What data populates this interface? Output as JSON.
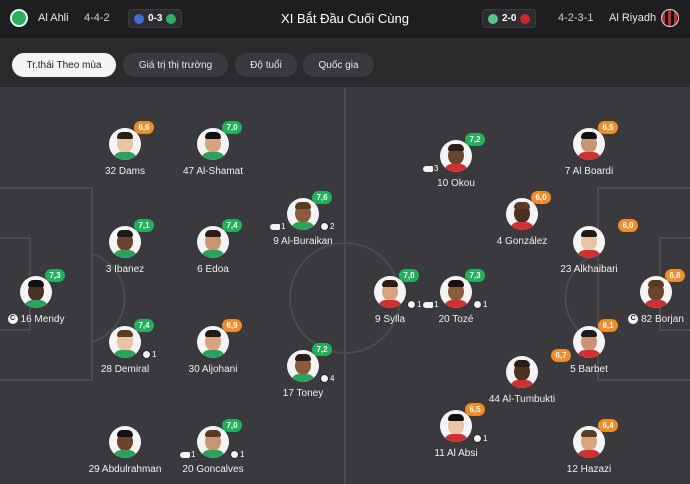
{
  "header": {
    "home_team": "Al Ahli",
    "home_formation": "4-4-2",
    "home_recent_score": "0-3",
    "title": "XI Bắt Đầu Cuối Cùng",
    "away_recent_score": "2-0",
    "away_formation": "4-2-3-1",
    "away_team": "Al Riyadh"
  },
  "tabs": [
    {
      "label": "Tr.thái Theo mùa",
      "active": true
    },
    {
      "label": "Giá trị thị trường",
      "active": false
    },
    {
      "label": "Độ tuổi",
      "active": false
    },
    {
      "label": "Quốc gia",
      "active": false
    }
  ],
  "colors": {
    "rating_green": "#21b15b",
    "rating_orange": "#f08d2a",
    "rating_red": "#e5483c",
    "pitch": "#3a3a3e"
  },
  "home_players": [
    {
      "name": "32 Dams",
      "rating": "6,6"
    },
    {
      "name": "47 Al-Shamat",
      "rating": "7,0"
    },
    {
      "name": "9 Al-Buraikan",
      "rating": "7,6",
      "assists": "1",
      "goals": "2"
    },
    {
      "name": "3 Ibanez",
      "rating": "7,1"
    },
    {
      "name": "6 Edoa",
      "rating": "7,4"
    },
    {
      "name": "16 Mendy",
      "rating": "7,3",
      "captain": "C"
    },
    {
      "name": "28 Demiral",
      "rating": "7,4",
      "goals": "1"
    },
    {
      "name": "30 Aljohani",
      "rating": "6,9"
    },
    {
      "name": "17 Toney",
      "rating": "7,2",
      "goals": "4"
    },
    {
      "name": "29 Abdulrahman",
      "rating": ""
    },
    {
      "name": "20 Goncalves",
      "rating": "7,0",
      "assists": "1",
      "goals": "1"
    }
  ],
  "away_players": [
    {
      "name": "10 Okou",
      "rating": "7,2",
      "assists": "3"
    },
    {
      "name": "7 Al Boardi",
      "rating": "6,5"
    },
    {
      "name": "4 González",
      "rating": "6,0"
    },
    {
      "name": "23 Alkhaibari",
      "rating": "6,0"
    },
    {
      "name": "9 Sylla",
      "rating": "7,0",
      "goals": "1"
    },
    {
      "name": "20 Tozé",
      "rating": "7,3",
      "assists": "1",
      "goals": "1"
    },
    {
      "name": "82 Borjan",
      "rating": "6,8",
      "captain": "C"
    },
    {
      "name": "5 Barbet",
      "rating": "6,1"
    },
    {
      "name": "44 Al-Tumbukti",
      "rating": "6,7"
    },
    {
      "name": "11 Al Absi",
      "rating": "6,5",
      "goals": "1"
    },
    {
      "name": "12 Hazazi",
      "rating": "6,4"
    }
  ]
}
